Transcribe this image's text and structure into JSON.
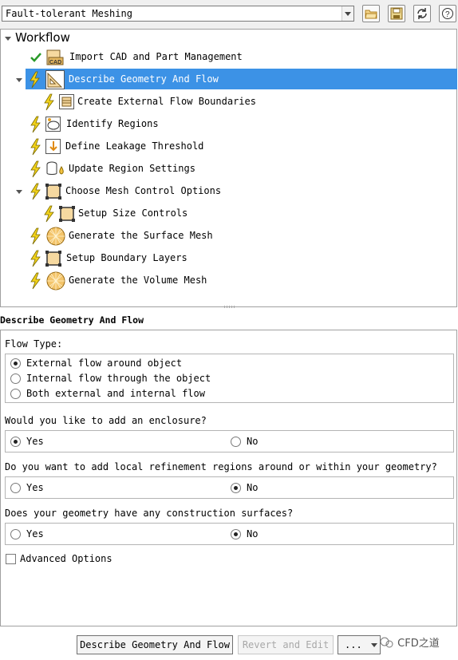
{
  "topbar": {
    "workflow_type": "Fault-tolerant Meshing",
    "tools": [
      "open-folder-icon",
      "save-icon",
      "refresh-icon",
      "help-icon"
    ]
  },
  "tree": {
    "title": "Workflow",
    "steps": [
      {
        "label": "Import CAD and Part Management",
        "status": "done",
        "icon": "cad-icon"
      },
      {
        "label": "Describe Geometry And Flow",
        "status": "pending",
        "icon": "geometry-icon",
        "selected": true,
        "expanded": true
      },
      {
        "label": "Create External Flow Boundaries",
        "status": "pending",
        "icon": "boundary-icon",
        "child": true
      },
      {
        "label": "Identify Regions",
        "status": "pending",
        "icon": "region-icon"
      },
      {
        "label": "Define Leakage Threshold",
        "status": "pending",
        "icon": "leakage-icon"
      },
      {
        "label": "Update Region Settings",
        "status": "pending",
        "icon": "region-settings-icon"
      },
      {
        "label": "Choose Mesh Control Options",
        "status": "pending",
        "icon": "mesh-control-icon",
        "expanded": true
      },
      {
        "label": "Setup Size Controls",
        "status": "pending",
        "icon": "size-controls-icon",
        "child": true
      },
      {
        "label": "Generate the Surface Mesh",
        "status": "pending",
        "icon": "mesh-sphere-icon"
      },
      {
        "label": "Setup Boundary Layers",
        "status": "pending",
        "icon": "boundary-layers-icon"
      },
      {
        "label": "Generate the Volume Mesh",
        "status": "pending",
        "icon": "mesh-sphere-icon"
      }
    ]
  },
  "panel": {
    "title": "Describe Geometry And Flow",
    "flow_type": {
      "label": "Flow Type:",
      "options": [
        "External flow around object",
        "Internal flow through the object",
        "Both external and internal flow"
      ],
      "selected": 0
    },
    "enclosure": {
      "question": "Would you like to add an enclosure?",
      "yes": "Yes",
      "no": "No",
      "selected": "Yes"
    },
    "refinement": {
      "question": "Do you want to add local refinement regions around or within your geometry?",
      "yes": "Yes",
      "no": "No",
      "selected": "No"
    },
    "construction": {
      "question": "Does your geometry have any construction surfaces?",
      "yes": "Yes",
      "no": "No",
      "selected": "No"
    },
    "advanced": {
      "label": "Advanced Options",
      "checked": false
    }
  },
  "buttons": {
    "primary": "Describe Geometry And Flow",
    "revert": "Revert and Edit",
    "more": "..."
  },
  "watermark": "CFD之道",
  "colors": {
    "selection": "#3c92e6",
    "lightning": "#f2d21a",
    "check": "#2a9a2a"
  }
}
